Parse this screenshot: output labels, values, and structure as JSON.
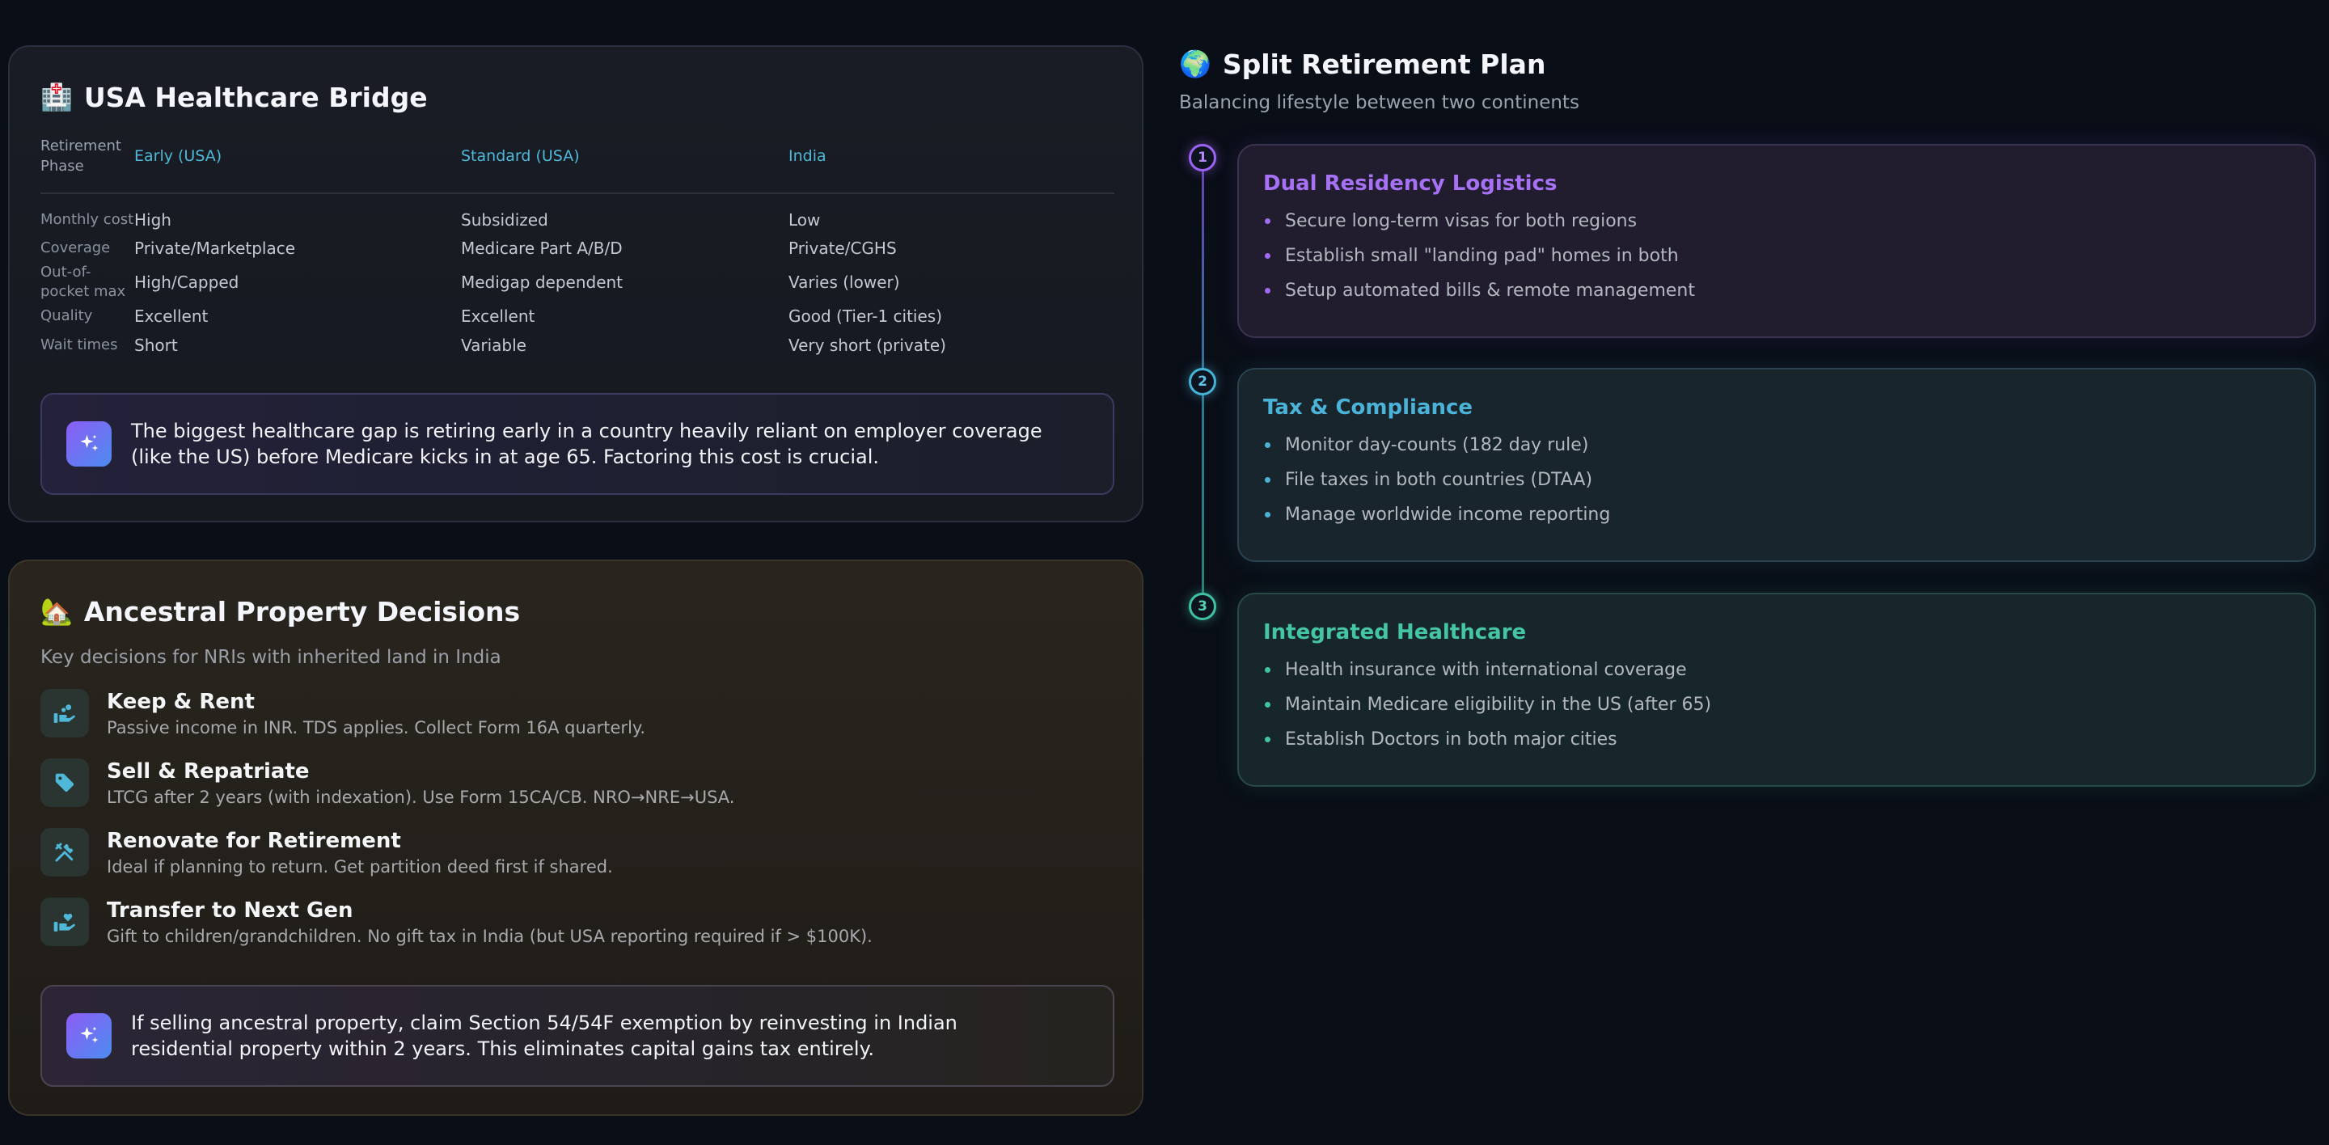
{
  "healthcare": {
    "emoji": "🏥",
    "title": "USA Healthcare Bridge",
    "headers": [
      "Retirement Phase",
      "Early (USA)",
      "Standard (USA)",
      "India"
    ],
    "rows": [
      [
        "Monthly cost",
        "High",
        "Subsidized",
        "Low"
      ],
      [
        "Coverage",
        "Private/Marketplace",
        "Medicare Part A/B/D",
        "Private/CGHS"
      ],
      [
        "Out-of-pocket max",
        "High/Capped",
        "Medigap dependent",
        "Varies (lower)"
      ],
      [
        "Quality",
        "Excellent",
        "Excellent",
        "Good (Tier-1 cities)"
      ],
      [
        "Wait times",
        "Short",
        "Variable",
        "Very short (private)"
      ]
    ],
    "insight": "The biggest healthcare gap is retiring early in a country heavily reliant on employer coverage (like the US) before Medicare kicks in at age 65. Factoring this cost is crucial."
  },
  "property": {
    "emoji": "🏡",
    "title": "Ancestral Property Decisions",
    "subtitle": "Key decisions for NRIs with inherited land in India",
    "items": [
      {
        "icon": "hand-coins-icon",
        "title": "Keep & Rent",
        "desc": "Passive income in INR. TDS applies. Collect Form 16A quarterly."
      },
      {
        "icon": "tag-icon",
        "title": "Sell & Repatriate",
        "desc": "LTCG after 2 years (with indexation). Use Form 15CA/CB. NRO→NRE→USA."
      },
      {
        "icon": "tools-icon",
        "title": "Renovate for Retirement",
        "desc": "Ideal if planning to return. Get partition deed first if shared."
      },
      {
        "icon": "hand-heart-icon",
        "title": "Transfer to Next Gen",
        "desc": "Gift to children/grandchildren. No gift tax in India (but USA reporting required if > $100K)."
      }
    ],
    "insight": "If selling ancestral property, claim Section 54/54F exemption by reinvesting in Indian residential property within 2 years. This eliminates capital gains tax entirely."
  },
  "split": {
    "emoji": "🌍",
    "title": "Split Retirement Plan",
    "subtitle": "Balancing lifestyle between two continents",
    "steps": [
      {
        "number": "1",
        "title": "Dual Residency Logistics",
        "items": [
          "Secure long-term visas for both regions",
          "Establish small \"landing pad\" homes in both",
          "Setup automated bills & remote management"
        ]
      },
      {
        "number": "2",
        "title": "Tax & Compliance",
        "items": [
          "Monitor day-counts (182 day rule)",
          "File taxes in both countries (DTAA)",
          "Manage worldwide income reporting"
        ]
      },
      {
        "number": "3",
        "title": "Integrated Healthcare",
        "items": [
          "Health insurance with international coverage",
          "Maintain Medicare eligibility in the US (after 65)",
          "Establish Doctors in both major cities"
        ]
      }
    ]
  },
  "colors": {
    "background": "#0a0e17",
    "accent_cyan": "#4fb8d8",
    "step1": "#a671f5",
    "step2": "#4cb3d8",
    "step3": "#44c5a5"
  }
}
